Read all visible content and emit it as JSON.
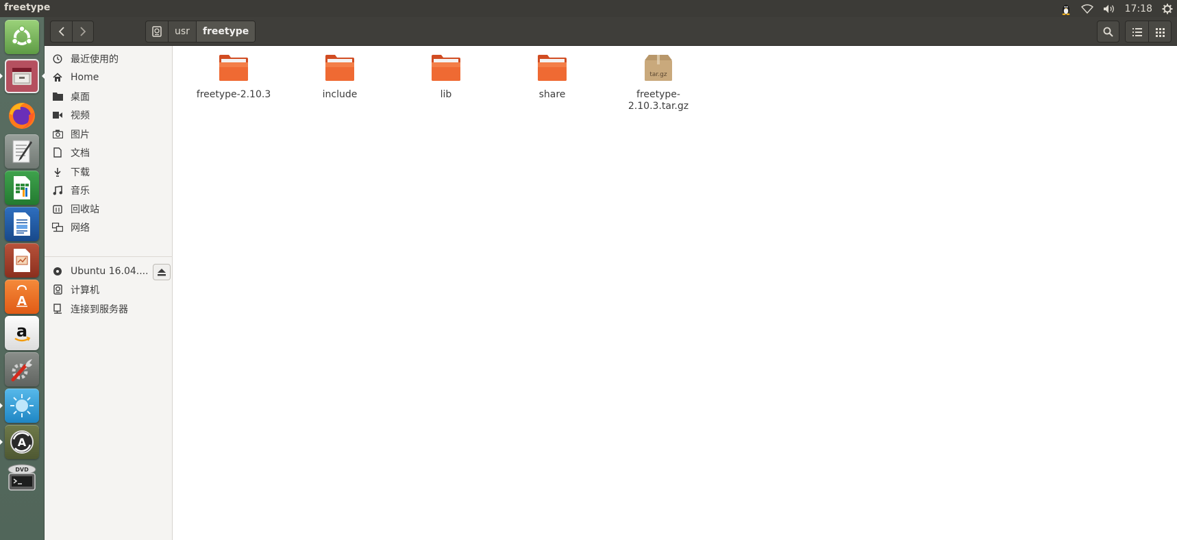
{
  "window": {
    "title": "freetype"
  },
  "panel": {
    "time": "17:18"
  },
  "header": {
    "breadcrumbs": [
      "usr",
      "freetype"
    ]
  },
  "sidebar": {
    "places": [
      {
        "label": "最近使用的",
        "icon": "clock-icon"
      },
      {
        "label": "Home",
        "icon": "home-icon"
      },
      {
        "label": "桌面",
        "icon": "folder-icon"
      },
      {
        "label": "视频",
        "icon": "video-icon"
      },
      {
        "label": "图片",
        "icon": "camera-icon"
      },
      {
        "label": "文档",
        "icon": "document-icon"
      },
      {
        "label": "下载",
        "icon": "download-icon"
      },
      {
        "label": "音乐",
        "icon": "music-icon"
      },
      {
        "label": "回收站",
        "icon": "trash-icon"
      },
      {
        "label": "网络",
        "icon": "network-icon"
      }
    ],
    "devices": [
      {
        "label": "Ubuntu 16.04....",
        "icon": "disc-icon"
      },
      {
        "label": "计算机",
        "icon": "computer-icon"
      },
      {
        "label": "连接到服务器",
        "icon": "server-icon"
      }
    ]
  },
  "files": [
    {
      "name": "freetype-2.10.3",
      "type": "folder"
    },
    {
      "name": "include",
      "type": "folder"
    },
    {
      "name": "lib",
      "type": "folder"
    },
    {
      "name": "share",
      "type": "folder"
    },
    {
      "name": "freetype-2.10.3.tar.gz",
      "type": "archive",
      "badge": "tar.gz"
    }
  ],
  "launcher": [
    {
      "name": "ubuntu-dash"
    },
    {
      "name": "files"
    },
    {
      "name": "firefox"
    },
    {
      "name": "text-editor"
    },
    {
      "name": "libreoffice-calc"
    },
    {
      "name": "libreoffice-writer"
    },
    {
      "name": "libreoffice-impress"
    },
    {
      "name": "ubuntu-software"
    },
    {
      "name": "amazon"
    },
    {
      "name": "system-settings"
    },
    {
      "name": "unknown-app"
    },
    {
      "name": "software-updater"
    },
    {
      "name": "dvd"
    }
  ],
  "colors": {
    "folder": "#e9572a",
    "folder_top": "#f27d4e",
    "archive": "#c6a77a",
    "panel": "#3c3b37",
    "headerbar": "#3f3e3a"
  }
}
